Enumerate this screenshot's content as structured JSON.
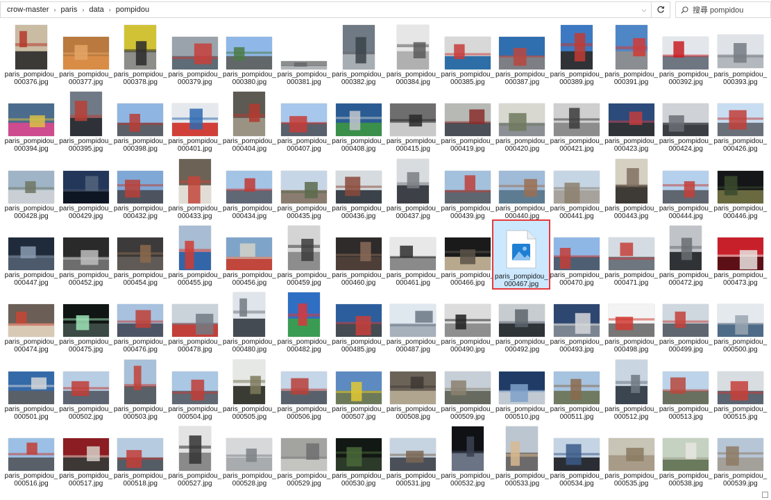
{
  "address_bar": {
    "breadcrumbs": [
      "crow-master",
      "paris",
      "data",
      "pompidou"
    ]
  },
  "search": {
    "placeholder": "搜尋 pompidou"
  },
  "colors": {
    "selection_bg": "#cce8ff",
    "selection_border": "#e4393c",
    "image_icon_blue": "#1e7fd3"
  },
  "selected_index": 75,
  "files": [
    {
      "name": "paris_pompidou_000376.jpg",
      "shape": "port",
      "c": [
        "#c9bca3",
        "#b5382c",
        "#3b3a37"
      ]
    },
    {
      "name": "paris_pompidou_000377.jpg",
      "shape": "land",
      "c": [
        "#b9793f",
        "#e3a565",
        "#d98c46"
      ]
    },
    {
      "name": "paris_pompidou_000378.jpg",
      "shape": "port",
      "c": [
        "#d1c235",
        "#2c2c2c",
        "#8d8d8a"
      ]
    },
    {
      "name": "paris_pompidou_000379.jpg",
      "shape": "land",
      "c": [
        "#9aa3ab",
        "#c6403b",
        "#5d6c77"
      ]
    },
    {
      "name": "paris_pompidou_000380.jpg",
      "shape": "land",
      "c": [
        "#8fb8e8",
        "#4d7a45",
        "#62686a"
      ]
    },
    {
      "name": "paris_pompidou_000381.jpg",
      "shape": "wide",
      "c": [
        "#8d8f8f",
        "#64686b",
        "#b3b6b8"
      ]
    },
    {
      "name": "paris_pompidou_000382.jpg",
      "shape": "port",
      "c": [
        "#6f7a85",
        "#3c4349",
        "#a6adb3"
      ]
    },
    {
      "name": "paris_pompidou_000384.jpg",
      "shape": "port",
      "c": [
        "#e6e6e6",
        "#5b5b5b",
        "#b0b0b0"
      ]
    },
    {
      "name": "paris_pompidou_000385.jpg",
      "shape": "land",
      "c": [
        "#d8d8d8",
        "#c83c3c",
        "#2d6ea6"
      ]
    },
    {
      "name": "paris_pompidou_000387.jpg",
      "shape": "land",
      "c": [
        "#2f6fb0",
        "#b9463f",
        "#7d7f85"
      ]
    },
    {
      "name": "paris_pompidou_000389.jpg",
      "shape": "port",
      "c": [
        "#3c79c2",
        "#c23b33",
        "#2f3337"
      ]
    },
    {
      "name": "paris_pompidou_000391.jpg",
      "shape": "port",
      "c": [
        "#4f86c6",
        "#cf3b36",
        "#8a8d91"
      ]
    },
    {
      "name": "paris_pompidou_000392.jpg",
      "shape": "land",
      "c": [
        "#e3e7ec",
        "#c81e25",
        "#6e7682"
      ]
    },
    {
      "name": "paris_pompidou_000393.jpg",
      "shape": "land2",
      "c": [
        "#dfe3e8",
        "#767b82",
        "#b3b8be"
      ]
    },
    {
      "name": "paris_pompidou_000394.jpg",
      "shape": "land",
      "c": [
        "#4b6c8c",
        "#d9bf46",
        "#cd4b8e"
      ]
    },
    {
      "name": "paris_pompidou_000395.jpg",
      "shape": "port",
      "c": [
        "#707a86",
        "#b84036",
        "#2e3238"
      ]
    },
    {
      "name": "paris_pompidou_000398.jpg",
      "shape": "land",
      "c": [
        "#8fb6e2",
        "#b73d37",
        "#5c6068"
      ]
    },
    {
      "name": "paris_pompidou_000401.jpg",
      "shape": "land",
      "c": [
        "#e5e9ee",
        "#2f6ab0",
        "#d04039"
      ]
    },
    {
      "name": "paris_pompidou_000404.jpg",
      "shape": "port",
      "c": [
        "#5c5a52",
        "#b43a2f",
        "#9a9384"
      ]
    },
    {
      "name": "paris_pompidou_000407.jpg",
      "shape": "land",
      "c": [
        "#a7c7ec",
        "#c53c38",
        "#58606b"
      ]
    },
    {
      "name": "paris_pompidou_000408.jpg",
      "shape": "land",
      "c": [
        "#2a5c93",
        "#c2c7cc",
        "#3a8f4a"
      ]
    },
    {
      "name": "paris_pompidou_000415.jpg",
      "shape": "land",
      "c": [
        "#6e6e6e",
        "#2a2a2a",
        "#c9c9c9"
      ]
    },
    {
      "name": "paris_pompidou_000419.jpg",
      "shape": "land",
      "c": [
        "#b7b9b5",
        "#8a2e2b",
        "#4b5058"
      ]
    },
    {
      "name": "paris_pompidou_000420.jpg",
      "shape": "land",
      "c": [
        "#d8d8d0",
        "#6f7a5e",
        "#8c8f94"
      ]
    },
    {
      "name": "paris_pompidou_000421.jpg",
      "shape": "land",
      "c": [
        "#cfcfcf",
        "#3c3c3c",
        "#8d8d8d"
      ]
    },
    {
      "name": "paris_pompidou_000423.jpg",
      "shape": "land",
      "c": [
        "#2c4a7a",
        "#c23d3f",
        "#303338"
      ]
    },
    {
      "name": "paris_pompidou_000424.jpg",
      "shape": "land",
      "c": [
        "#cfd2d6",
        "#6b6f74",
        "#3b3e42"
      ]
    },
    {
      "name": "paris_pompidou_000426.jpg",
      "shape": "land",
      "c": [
        "#c8ddf2",
        "#c13e3a",
        "#6a7079"
      ]
    },
    {
      "name": "paris_pompidou_000428.jpg",
      "shape": "land",
      "c": [
        "#9fb4c6",
        "#6f7764",
        "#c9cfd4"
      ]
    },
    {
      "name": "paris_pompidou_000429.jpg",
      "shape": "land",
      "c": [
        "#23375a",
        "#54657c",
        "#0e1624"
      ]
    },
    {
      "name": "paris_pompidou_000432.jpg",
      "shape": "land",
      "c": [
        "#7fa8d6",
        "#b94037",
        "#4d5460"
      ]
    },
    {
      "name": "paris_pompidou_000433.jpg",
      "shape": "port",
      "c": [
        "#6c6256",
        "#c3473c",
        "#e2ddd4"
      ]
    },
    {
      "name": "paris_pompidou_000434.jpg",
      "shape": "land",
      "c": [
        "#a4c4e6",
        "#c13a34",
        "#606875"
      ]
    },
    {
      "name": "paris_pompidou_000435.jpg",
      "shape": "land",
      "c": [
        "#c7d6e6",
        "#5b6b4c",
        "#8a7c70"
      ]
    },
    {
      "name": "paris_pompidou_000436.jpg",
      "shape": "land",
      "c": [
        "#d6dbe0",
        "#8a4a3a",
        "#3b4249"
      ]
    },
    {
      "name": "paris_pompidou_000437.jpg",
      "shape": "port",
      "c": [
        "#d9dcdf",
        "#7a7e83",
        "#3d4147"
      ]
    },
    {
      "name": "paris_pompidou_000439.jpg",
      "shape": "land",
      "c": [
        "#a3c0dc",
        "#bf3f39",
        "#5e6670"
      ]
    },
    {
      "name": "paris_pompidou_000440.jpg",
      "shape": "land",
      "c": [
        "#9fbbd8",
        "#9a6f52",
        "#5e7c91"
      ]
    },
    {
      "name": "paris_pompidou_000441.jpg",
      "shape": "land",
      "c": [
        "#c6d5e4",
        "#8d8070",
        "#a7a39c"
      ]
    },
    {
      "name": "paris_pompidou_000443.jpg",
      "shape": "port",
      "c": [
        "#d6d0c2",
        "#807060",
        "#3e3a36"
      ]
    },
    {
      "name": "paris_pompidou_000444.jpg",
      "shape": "land",
      "c": [
        "#b4d0ec",
        "#c3403a",
        "#5f6670"
      ]
    },
    {
      "name": "paris_pompidou_000446.jpg",
      "shape": "land",
      "c": [
        "#141618",
        "#3a4a2e",
        "#6a6a40"
      ]
    },
    {
      "name": "paris_pompidou_000447.jpg",
      "shape": "land",
      "c": [
        "#1f2a3b",
        "#8b9bb0",
        "#4c5a6c"
      ]
    },
    {
      "name": "paris_pompidou_000452.jpg",
      "shape": "land",
      "c": [
        "#2a2a2a",
        "#bdbdbd",
        "#6d6d6d"
      ]
    },
    {
      "name": "paris_pompidou_000454.jpg",
      "shape": "land",
      "c": [
        "#3c3a3a",
        "#8b6a4c",
        "#5f5a55"
      ]
    },
    {
      "name": "paris_pompidou_000455.jpg",
      "shape": "port",
      "c": [
        "#a8bdd3",
        "#d03c33",
        "#3266a8"
      ]
    },
    {
      "name": "paris_pompidou_000456.jpg",
      "shape": "land",
      "c": [
        "#7fa4c9",
        "#d2d2c8",
        "#c1473c"
      ]
    },
    {
      "name": "paris_pompidou_000459.jpg",
      "shape": "port",
      "c": [
        "#d4d4d4",
        "#3c3c3c",
        "#8d8d8d"
      ]
    },
    {
      "name": "paris_pompidou_000460.jpg",
      "shape": "land",
      "c": [
        "#2e2b2a",
        "#8a6a58",
        "#4d3f38"
      ]
    },
    {
      "name": "paris_pompidou_000461.jpg",
      "shape": "land",
      "c": [
        "#e8e8e8",
        "#2e2e2e",
        "#8a8a8a"
      ]
    },
    {
      "name": "paris_pompidou_000466.jpg",
      "shape": "land",
      "c": [
        "#1a1a1a",
        "#5a5248",
        "#b8a88e"
      ]
    },
    {
      "name": "paris_pompidou_000467.jpg",
      "shape": "icon",
      "c": [
        "#ffffff",
        "#1e7fd3",
        "#8fc3ef"
      ]
    },
    {
      "name": "paris_pompidou_000470.jpg",
      "shape": "land",
      "c": [
        "#8fb7e6",
        "#c43d37",
        "#4e5f73"
      ]
    },
    {
      "name": "paris_pompidou_000471.jpg",
      "shape": "land",
      "c": [
        "#d5dbe2",
        "#c4403a",
        "#6e7680"
      ]
    },
    {
      "name": "paris_pompidou_000472.jpg",
      "shape": "port",
      "c": [
        "#c0c4c8",
        "#6a6e73",
        "#2f3336"
      ]
    },
    {
      "name": "paris_pompidou_000473.jpg",
      "shape": "land",
      "c": [
        "#c8202b",
        "#e7e3e0",
        "#5c1015"
      ]
    },
    {
      "name": "paris_pompidou_000474.jpg",
      "shape": "land",
      "c": [
        "#6a5e57",
        "#c94535",
        "#d8c9b5"
      ]
    },
    {
      "name": "paris_pompidou_000475.jpg",
      "shape": "land",
      "c": [
        "#101614",
        "#9ee3b6",
        "#3b4a44"
      ]
    },
    {
      "name": "paris_pompidou_000476.jpg",
      "shape": "land",
      "c": [
        "#a7c1de",
        "#be4038",
        "#4c5566"
      ]
    },
    {
      "name": "paris_pompidou_000478.jpg",
      "shape": "land",
      "c": [
        "#cad2da",
        "#727a83",
        "#c2403a"
      ]
    },
    {
      "name": "paris_pompidou_000480.jpg",
      "shape": "port",
      "c": [
        "#dfe5ea",
        "#737b82",
        "#454b52"
      ]
    },
    {
      "name": "paris_pompidou_000482.jpg",
      "shape": "port",
      "c": [
        "#2f6fc3",
        "#d63a3e",
        "#3a9c52"
      ]
    },
    {
      "name": "paris_pompidou_000485.jpg",
      "shape": "land",
      "c": [
        "#2c5e9d",
        "#c83e3a",
        "#444b52"
      ]
    },
    {
      "name": "paris_pompidou_000487.jpg",
      "shape": "land",
      "c": [
        "#dfe7ef",
        "#6b7885",
        "#a6b1bc"
      ]
    },
    {
      "name": "paris_pompidou_000490.jpg",
      "shape": "land",
      "c": [
        "#dcdcdc",
        "#202020",
        "#8f8f8f"
      ]
    },
    {
      "name": "paris_pompidou_000492.jpg",
      "shape": "land",
      "c": [
        "#c7ccd1",
        "#5d646b",
        "#2f3439"
      ]
    },
    {
      "name": "paris_pompidou_000493.jpg",
      "shape": "land",
      "c": [
        "#2e4770",
        "#d6d8da",
        "#7b8591"
      ]
    },
    {
      "name": "paris_pompidou_000498.jpg",
      "shape": "land",
      "c": [
        "#f3f3f3",
        "#d13a32",
        "#777777"
      ]
    },
    {
      "name": "paris_pompidou_000499.jpg",
      "shape": "land",
      "c": [
        "#cfd7df",
        "#c4413a",
        "#5f6670"
      ]
    },
    {
      "name": "paris_pompidou_000500.jpg",
      "shape": "land",
      "c": [
        "#e4e9ee",
        "#9aa6b1",
        "#4e6c88"
      ]
    },
    {
      "name": "paris_pompidou_000501.jpg",
      "shape": "land",
      "c": [
        "#356aa8",
        "#d4d6d8",
        "#5a6068"
      ]
    },
    {
      "name": "paris_pompidou_000502.jpg",
      "shape": "land",
      "c": [
        "#b7cde3",
        "#c13d37",
        "#5b6470"
      ]
    },
    {
      "name": "paris_pompidou_000503.jpg",
      "shape": "port",
      "c": [
        "#a8c0d9",
        "#c24238",
        "#5a6068"
      ]
    },
    {
      "name": "paris_pompidou_000504.jpg",
      "shape": "land",
      "c": [
        "#aac7e4",
        "#c03e38",
        "#606873"
      ]
    },
    {
      "name": "paris_pompidou_000505.jpg",
      "shape": "port",
      "c": [
        "#e6e8e6",
        "#7c7a5c",
        "#3a3c34"
      ]
    },
    {
      "name": "paris_pompidou_000506.jpg",
      "shape": "land",
      "c": [
        "#c4d6e8",
        "#b9403a",
        "#58616b"
      ]
    },
    {
      "name": "paris_pompidou_000507.jpg",
      "shape": "land",
      "c": [
        "#5d8ac0",
        "#e0c834",
        "#6d7a5a"
      ]
    },
    {
      "name": "paris_pompidou_000508.jpg",
      "shape": "land",
      "c": [
        "#6b6258",
        "#3e3a34",
        "#b0a690"
      ]
    },
    {
      "name": "paris_pompidou_000509.jpg",
      "shape": "land",
      "c": [
        "#c6cfd8",
        "#8b8170",
        "#676b5f"
      ]
    },
    {
      "name": "paris_pompidou_000510.jpg",
      "shape": "land",
      "c": [
        "#1f3b66",
        "#7ea1c9",
        "#c1c9d2"
      ]
    },
    {
      "name": "paris_pompidou_000511.jpg",
      "shape": "land",
      "c": [
        "#a6c3e0",
        "#8a6a4c",
        "#707a60"
      ]
    },
    {
      "name": "paris_pompidou_000512.jpg",
      "shape": "port",
      "c": [
        "#c9d6e2",
        "#6e7983",
        "#3b454f"
      ]
    },
    {
      "name": "paris_pompidou_000513.jpg",
      "shape": "land",
      "c": [
        "#bcd3ea",
        "#b94840",
        "#6a7060"
      ]
    },
    {
      "name": "paris_pompidou_000515.jpg",
      "shape": "land",
      "c": [
        "#d8dde2",
        "#c63f3a",
        "#5c6572"
      ]
    },
    {
      "name": "paris_pompidou_000516.jpg",
      "shape": "land",
      "c": [
        "#9cc0e5",
        "#c13d37",
        "#59606a"
      ]
    },
    {
      "name": "paris_pompidou_000517.jpg",
      "shape": "land",
      "c": [
        "#8c1d22",
        "#d7d0c8",
        "#3d3735"
      ]
    },
    {
      "name": "paris_pompidou_000518.jpg",
      "shape": "land",
      "c": [
        "#b6cbe0",
        "#c23d37",
        "#545c66"
      ]
    },
    {
      "name": "paris_pompidou_000527.jpg",
      "shape": "port",
      "c": [
        "#e3e3e3",
        "#323232",
        "#8a8a8a"
      ]
    },
    {
      "name": "paris_pompidou_000528.jpg",
      "shape": "land",
      "c": [
        "#d6d8d9",
        "#7e8286",
        "#a9acae"
      ]
    },
    {
      "name": "paris_pompidou_000529.jpg",
      "shape": "land",
      "c": [
        "#a3a3a0",
        "#6f706e",
        "#c4c4c0"
      ]
    },
    {
      "name": "paris_pompidou_000530.jpg",
      "shape": "land",
      "c": [
        "#121814",
        "#4a6a38",
        "#2c3a2a"
      ]
    },
    {
      "name": "paris_pompidou_000531.jpg",
      "shape": "land",
      "c": [
        "#c6d3e0",
        "#7a6654",
        "#4b5058"
      ]
    },
    {
      "name": "paris_pompidou_000532.jpg",
      "shape": "port",
      "c": [
        "#0f1114",
        "#3b4250",
        "#6a7485"
      ]
    },
    {
      "name": "paris_pompidou_000533.jpg",
      "shape": "port",
      "c": [
        "#bcc6d0",
        "#d8b890",
        "#6c6a6a"
      ]
    },
    {
      "name": "paris_pompidou_000534.jpg",
      "shape": "land",
      "c": [
        "#c4d4e4",
        "#3b5a88",
        "#2a2e34"
      ]
    },
    {
      "name": "paris_pompidou_000535.jpg",
      "shape": "land",
      "c": [
        "#c8c4b6",
        "#8a7a62",
        "#a89c88"
      ]
    },
    {
      "name": "paris_pompidou_000538.jpg",
      "shape": "land",
      "c": [
        "#c5d2c1",
        "#e6e6e0",
        "#6a7a5c"
      ]
    },
    {
      "name": "paris_pompidou_000539.jpg",
      "shape": "land",
      "c": [
        "#b6c6d6",
        "#8e7a64",
        "#a4a09a"
      ]
    }
  ]
}
